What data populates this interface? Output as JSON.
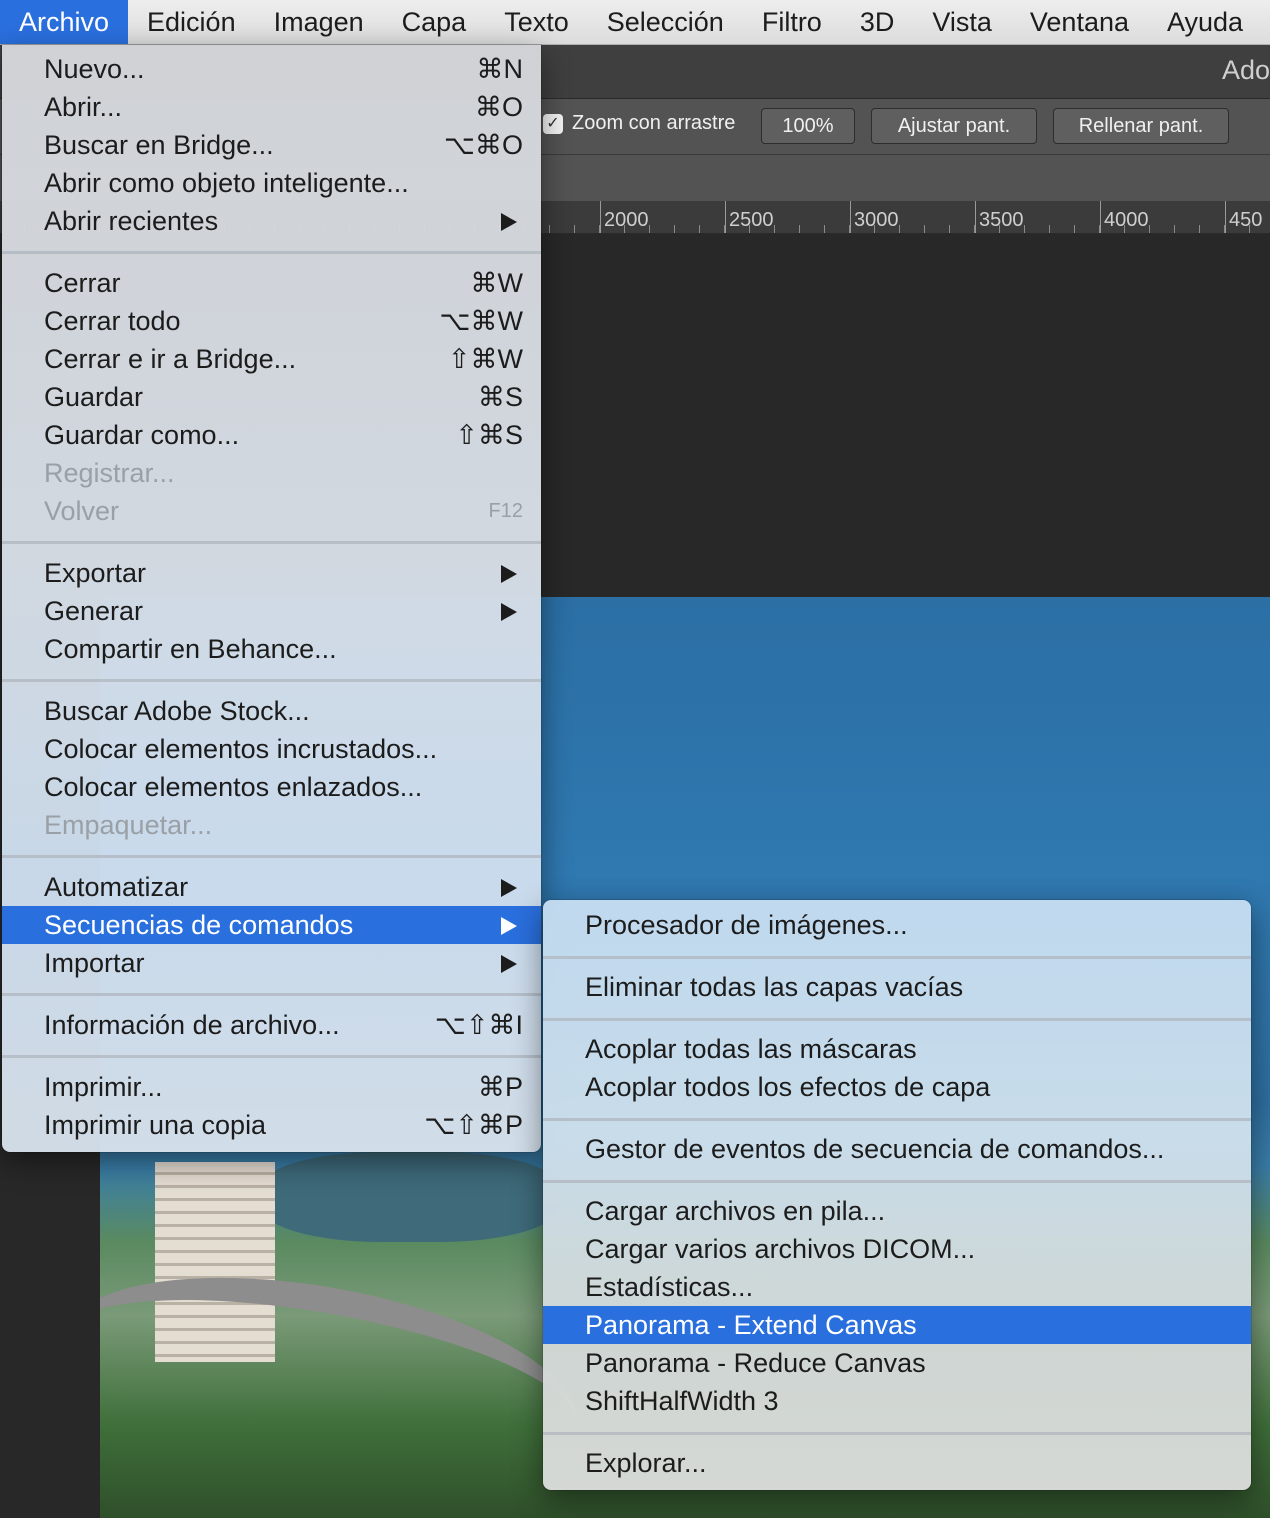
{
  "menubar": {
    "items": [
      "Archivo",
      "Edición",
      "Imagen",
      "Capa",
      "Texto",
      "Selección",
      "Filtro",
      "3D",
      "Vista",
      "Ventana",
      "Ayuda"
    ]
  },
  "app": {
    "title": "Ado"
  },
  "options_bar": {
    "zoom_drag_checked": true,
    "zoom_drag_label": "Zoom con arrastre",
    "zoom_button": "100%",
    "fit_button": "Ajustar pant.",
    "fill_button": "Rellenar pant."
  },
  "ruler": {
    "labels": [
      "2000",
      "2500",
      "3000",
      "3500",
      "4000",
      "450"
    ]
  },
  "file_menu": {
    "items": [
      {
        "label": "Nuevo...",
        "shortcut": "⌘N"
      },
      {
        "label": "Abrir...",
        "shortcut": "⌘O"
      },
      {
        "label": "Buscar en Bridge...",
        "shortcut": "⌥⌘O"
      },
      {
        "label": "Abrir como objeto inteligente..."
      },
      {
        "label": "Abrir recientes",
        "submenu": true
      },
      {
        "label": "Cerrar",
        "shortcut": "⌘W"
      },
      {
        "label": "Cerrar todo",
        "shortcut": "⌥⌘W"
      },
      {
        "label": "Cerrar e ir a Bridge...",
        "shortcut": "⇧⌘W"
      },
      {
        "label": "Guardar",
        "shortcut": "⌘S"
      },
      {
        "label": "Guardar como...",
        "shortcut": "⇧⌘S"
      },
      {
        "label": "Registrar...",
        "disabled": true
      },
      {
        "label": "Volver",
        "shortcut": "F12",
        "disabled": true
      },
      {
        "label": "Exportar",
        "submenu": true
      },
      {
        "label": "Generar",
        "submenu": true
      },
      {
        "label": "Compartir en Behance..."
      },
      {
        "label": "Buscar Adobe Stock..."
      },
      {
        "label": "Colocar elementos incrustados..."
      },
      {
        "label": "Colocar elementos enlazados..."
      },
      {
        "label": "Empaquetar...",
        "disabled": true
      },
      {
        "label": "Automatizar",
        "submenu": true
      },
      {
        "label": "Secuencias de comandos",
        "submenu": true,
        "selected": true
      },
      {
        "label": "Importar",
        "submenu": true
      },
      {
        "label": "Información de archivo...",
        "shortcut": "⌥⇧⌘I"
      },
      {
        "label": "Imprimir...",
        "shortcut": "⌘P"
      },
      {
        "label": "Imprimir una copia",
        "shortcut": "⌥⇧⌘P"
      }
    ]
  },
  "scripts_submenu": {
    "items": [
      {
        "label": "Procesador de imágenes..."
      },
      {
        "label": "Eliminar todas las capas vacías"
      },
      {
        "label": "Acoplar todas las máscaras"
      },
      {
        "label": "Acoplar todos los efectos de capa"
      },
      {
        "label": "Gestor de eventos de secuencia de comandos..."
      },
      {
        "label": "Cargar archivos en pila..."
      },
      {
        "label": "Cargar varios archivos DICOM..."
      },
      {
        "label": "Estadísticas..."
      },
      {
        "label": "Panorama - Extend Canvas",
        "selected": true
      },
      {
        "label": "Panorama - Reduce Canvas"
      },
      {
        "label": "ShiftHalfWidth 3"
      },
      {
        "label": "Explorar..."
      }
    ]
  },
  "colors": {
    "menu_highlight": "#2a6fde",
    "menubar_background": "#e6e6e6",
    "app_background": "#282828",
    "options_bar": "#535353"
  }
}
